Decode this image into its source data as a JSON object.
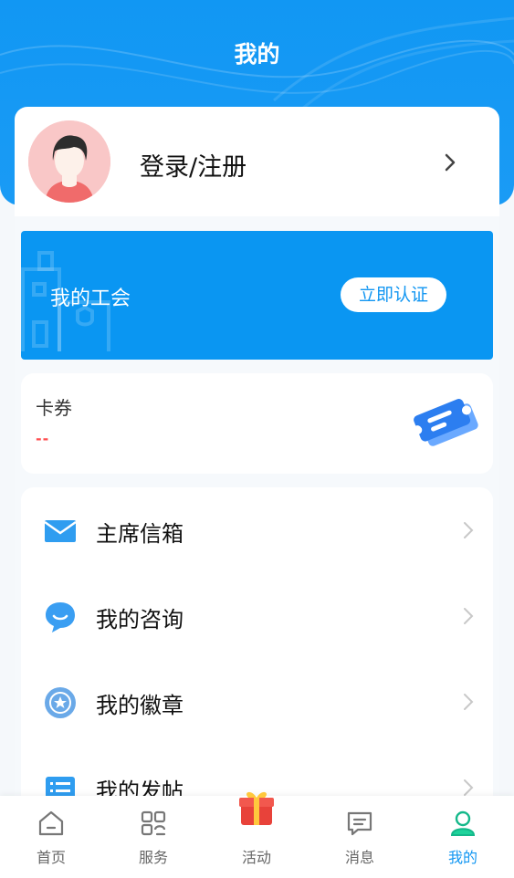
{
  "header": {
    "title": "我的"
  },
  "profile": {
    "login_label": "登录/注册"
  },
  "union": {
    "title": "我的工会",
    "certify_button": "立即认证"
  },
  "coupon": {
    "title": "卡券",
    "count": "--"
  },
  "menu": {
    "items": [
      {
        "label": "主席信箱",
        "icon": "mail-icon"
      },
      {
        "label": "我的咨询",
        "icon": "chat-bubble-icon"
      },
      {
        "label": "我的徽章",
        "icon": "badge-medal-icon"
      },
      {
        "label": "我的发帖",
        "icon": "post-list-icon"
      }
    ]
  },
  "tabbar": {
    "items": [
      {
        "label": "首页",
        "icon": "home-icon"
      },
      {
        "label": "服务",
        "icon": "grid-services-icon"
      },
      {
        "label": "活动",
        "icon": "gift-box-icon"
      },
      {
        "label": "消息",
        "icon": "message-icon"
      },
      {
        "label": "我的",
        "icon": "user-profile-icon"
      }
    ],
    "active_index": 4
  },
  "colors": {
    "primary": "#1196f2",
    "accent_red": "#ff4d4f",
    "active_tab": "#1196f2"
  }
}
